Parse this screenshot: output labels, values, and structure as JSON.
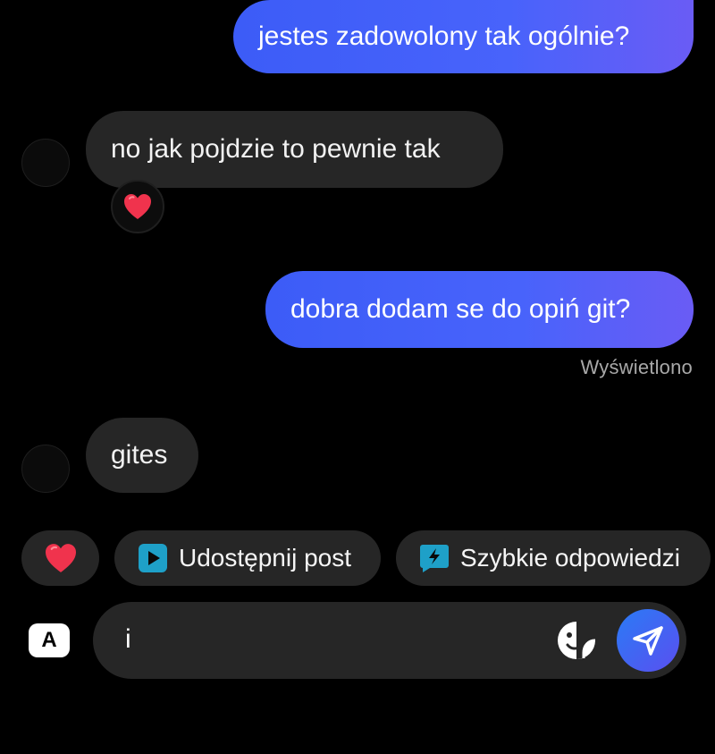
{
  "messages": [
    {
      "direction": "outgoing",
      "text": "jestes zadowolony tak ogólnie?"
    },
    {
      "direction": "incoming",
      "text": "no jak pojdzie to pewnie tak",
      "reaction": "heart-emoji"
    },
    {
      "direction": "outgoing",
      "text": "dobra dodam se do opiń git?",
      "status": "Wyświetlono"
    },
    {
      "direction": "incoming",
      "text": "gites"
    }
  ],
  "quick_actions": {
    "heart": "heart-emoji",
    "share_post": "Udostępnij post",
    "quick_replies": "Szybkie odpowiedzi"
  },
  "composer": {
    "value": "i",
    "keyboard_label": "A"
  },
  "colors": {
    "outgoing_bubble": "#4863fb",
    "incoming_bubble": "#262626",
    "heart": "#f0334d",
    "share_icon": "#1ea0c8",
    "background": "#000000"
  }
}
